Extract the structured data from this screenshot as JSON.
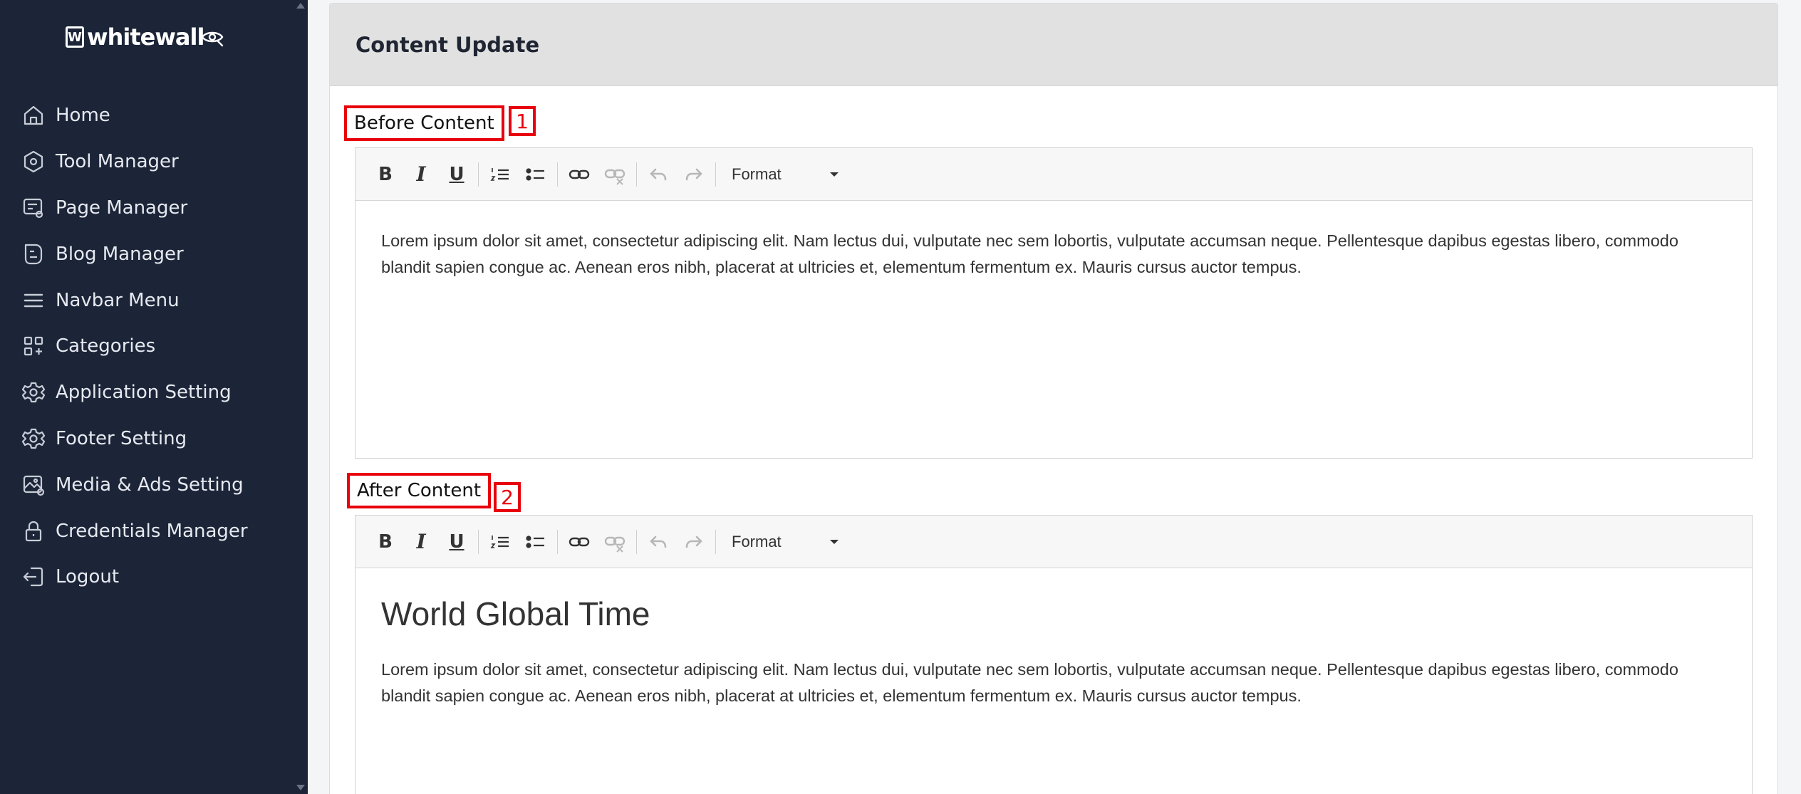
{
  "brand": {
    "name": "whitewall",
    "mark": "W",
    "eye_icon": "eye-icon"
  },
  "sidebar": {
    "items": [
      {
        "label": "Home",
        "icon": "home-icon"
      },
      {
        "label": "Tool Manager",
        "icon": "hexagon-icon"
      },
      {
        "label": "Page Manager",
        "icon": "page-settings-icon"
      },
      {
        "label": "Blog Manager",
        "icon": "blog-icon"
      },
      {
        "label": "Navbar Menu",
        "icon": "menu-icon"
      },
      {
        "label": "Categories",
        "icon": "grid-icon"
      },
      {
        "label": "Application Setting",
        "icon": "gear-icon"
      },
      {
        "label": "Footer Setting",
        "icon": "gear-icon"
      },
      {
        "label": "Media & Ads Setting",
        "icon": "image-settings-icon"
      },
      {
        "label": "Credentials Manager",
        "icon": "lock-icon"
      },
      {
        "label": "Logout",
        "icon": "logout-icon"
      }
    ]
  },
  "card": {
    "title": "Content Update"
  },
  "editors": {
    "before": {
      "label": "Before Content",
      "badge": "1",
      "format_label": "Format",
      "paragraph": "Lorem ipsum dolor sit amet, consectetur adipiscing elit. Nam lectus dui, vulputate nec sem lobortis, vulputate accumsan neque. Pellentesque dapibus egestas libero, commodo blandit sapien congue ac. Aenean eros nibh, placerat at ultricies et, elementum fermentum ex. Mauris cursus auctor tempus."
    },
    "after": {
      "label": "After Content",
      "badge": "2",
      "format_label": "Format",
      "heading": "World Global Time",
      "paragraph": "Lorem ipsum dolor sit amet, consectetur adipiscing elit. Nam lectus dui, vulputate nec sem lobortis, vulputate accumsan neque. Pellentesque dapibus egestas libero, commodo blandit sapien congue ac. Aenean eros nibh, placerat at ultricies et, elementum fermentum ex. Mauris cursus auctor tempus."
    }
  },
  "toolbar": {
    "bold": "B",
    "italic": "I",
    "underline": "U"
  },
  "colors": {
    "sidebar_bg": "#1c2538",
    "highlight_red": "#e8000b",
    "header_bg": "#e1e1e1"
  }
}
